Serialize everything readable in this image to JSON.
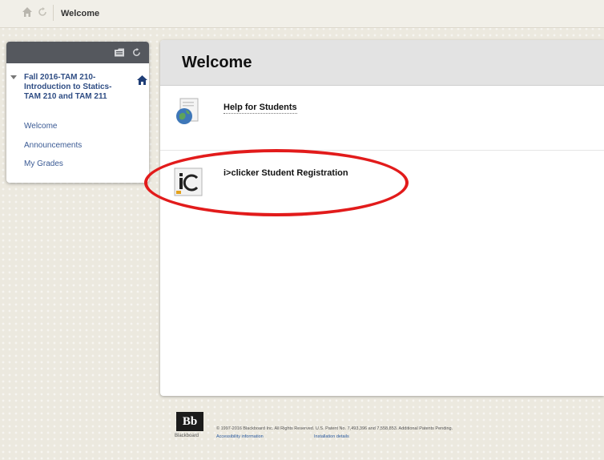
{
  "topbar": {
    "breadcrumb": "Welcome",
    "icons": [
      "home-icon",
      "refresh-icon"
    ]
  },
  "course_menu": {
    "header_icons": [
      "folder-view-icon",
      "refresh-icon"
    ],
    "course_title": "Fall 2016-TAM 210-Introduction to Statics-TAM 210 and TAM 211",
    "links": [
      "Welcome",
      "Announcements",
      "My Grades"
    ]
  },
  "content": {
    "page_title": "Welcome",
    "items": [
      {
        "title": "Help for Students",
        "icon": "globe-document-icon"
      },
      {
        "title": "i>clicker Student Registration",
        "icon": "iclicker-icon"
      }
    ],
    "highlight_color": "#e21b1b"
  },
  "footer": {
    "logo_text": "Bb",
    "logo_word": "Blackboard",
    "copyright": "© 1997-2016 Blackboard Inc. All Rights Reserved. U.S. Patent No. 7,493,396 and 7,558,853. Additional Patents Pending.",
    "links": [
      "Accessibility information",
      "Installation details"
    ]
  },
  "colors": {
    "accent_link": "#2f4d84",
    "menu_header": "#55585e",
    "page_background": "#ece9df"
  }
}
